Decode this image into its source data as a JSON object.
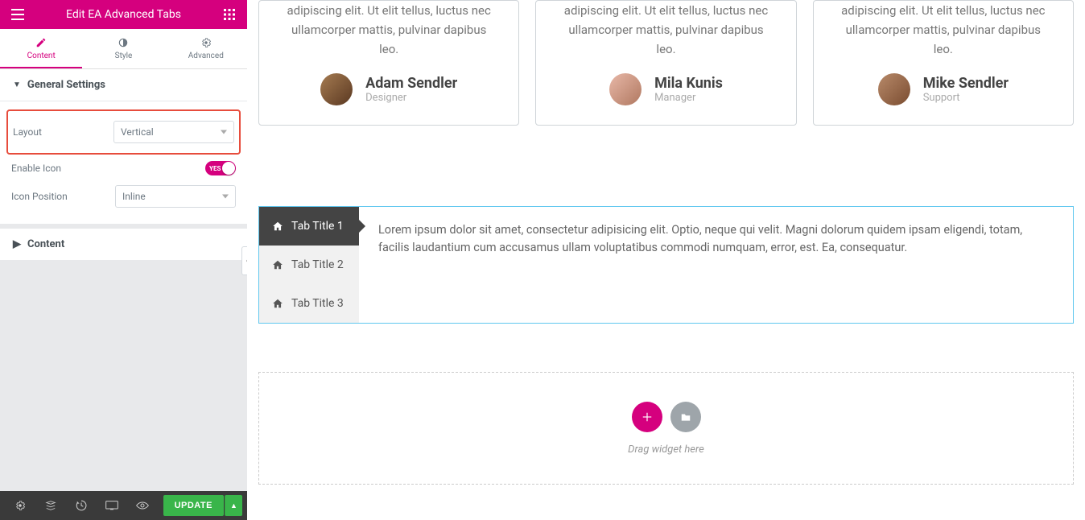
{
  "header": {
    "title": "Edit EA Advanced Tabs"
  },
  "pane_tabs": {
    "content": "Content",
    "style": "Style",
    "advanced": "Advanced"
  },
  "sections": {
    "general": {
      "title": "General Settings",
      "layout": {
        "label": "Layout",
        "value": "Vertical"
      },
      "enable_icon": {
        "label": "Enable Icon",
        "value": "YES"
      },
      "icon_position": {
        "label": "Icon Position",
        "value": "Inline"
      }
    },
    "content": {
      "title": "Content"
    }
  },
  "footer": {
    "update": "UPDATE"
  },
  "cards": [
    {
      "text": "adipiscing elit. Ut elit tellus, luctus nec ullamcorper mattis, pulvinar dapibus leo.",
      "name": "Adam Sendler",
      "role": "Designer"
    },
    {
      "text": "adipiscing elit. Ut elit tellus, luctus nec ullamcorper mattis, pulvinar dapibus leo.",
      "name": "Mila Kunis",
      "role": "Manager"
    },
    {
      "text": "adipiscing elit. Ut elit tellus, luctus nec ullamcorper mattis, pulvinar dapibus leo.",
      "name": "Mike Sendler",
      "role": "Support"
    }
  ],
  "tabs_widget": {
    "items": [
      {
        "label": "Tab Title 1"
      },
      {
        "label": "Tab Title 2"
      },
      {
        "label": "Tab Title 3"
      }
    ],
    "content": "Lorem ipsum dolor sit amet, consectetur adipisicing elit. Optio, neque qui velit. Magni dolorum quidem ipsam eligendi, totam, facilis laudantium cum accusamus ullam voluptatibus commodi numquam, error, est. Ea, consequatur."
  },
  "dropzone": {
    "hint": "Drag widget here"
  }
}
